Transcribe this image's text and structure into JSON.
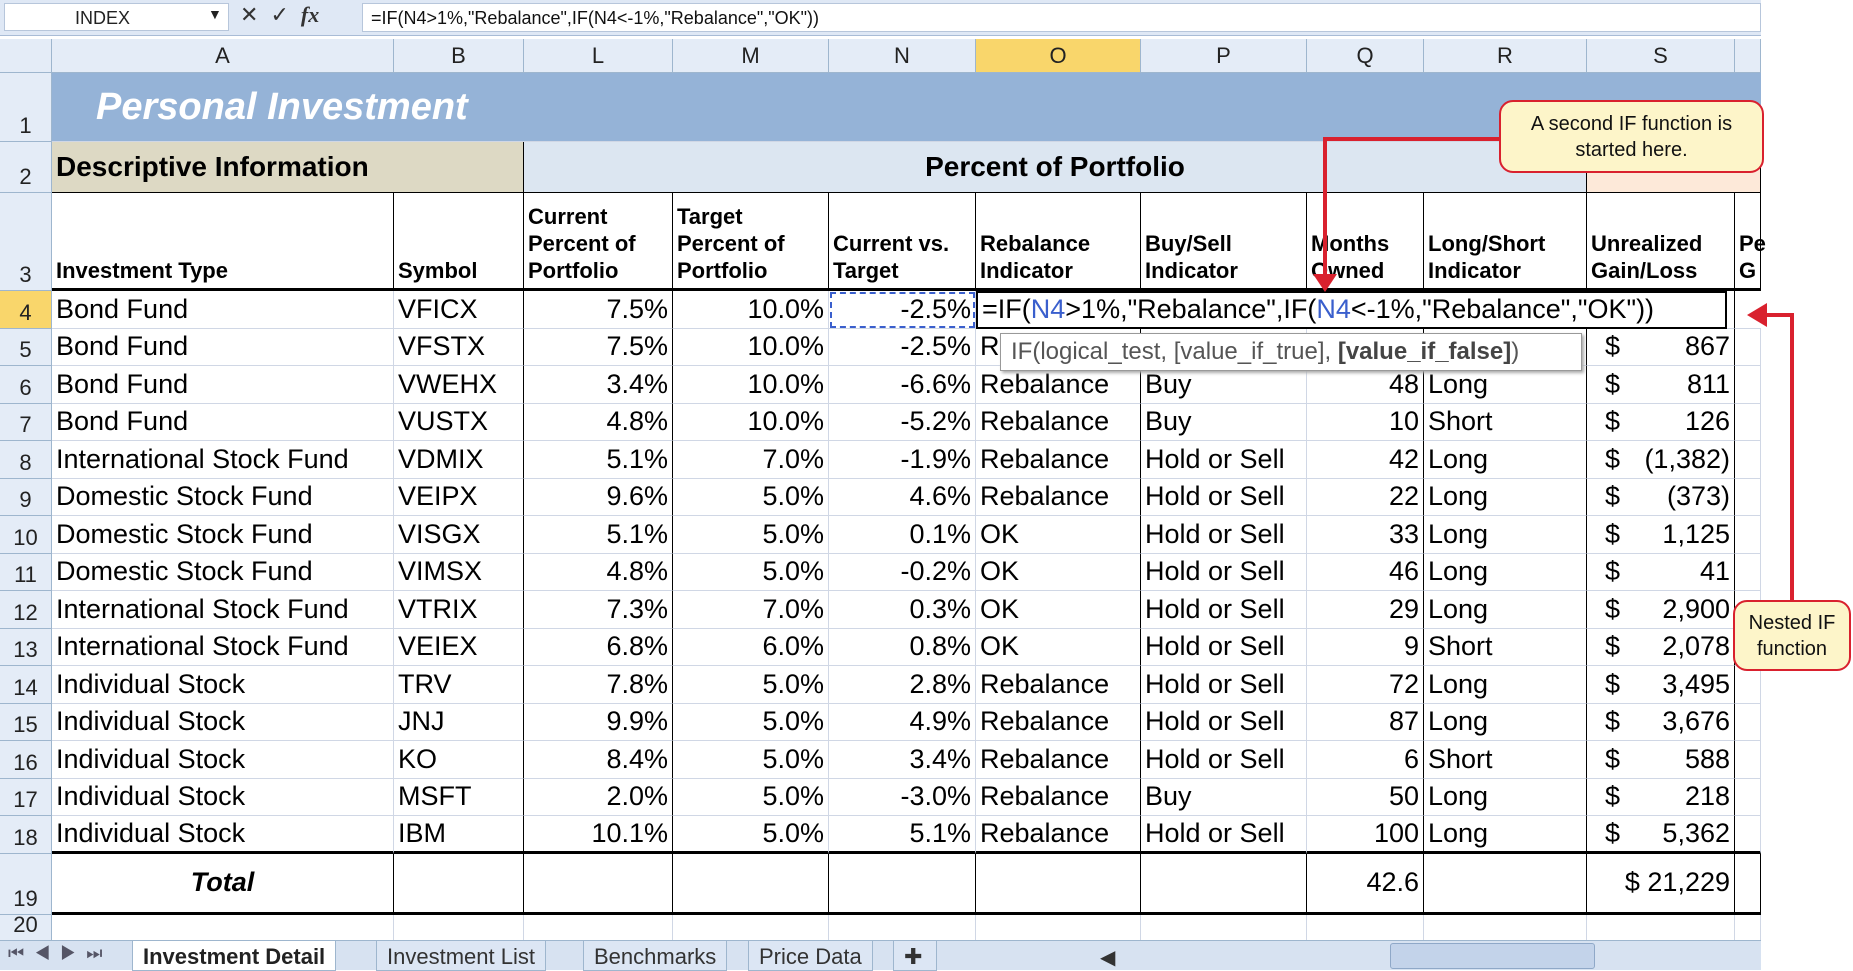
{
  "formula_bar": {
    "name_box": "INDEX",
    "formula": "=IF(N4>1%,\"Rebalance\",IF(N4<-1%,\"Rebalance\",\"OK\"))",
    "cancel": "✕",
    "enter": "✓",
    "fx": "fx"
  },
  "columns": [
    "A",
    "B",
    "L",
    "M",
    "N",
    "O",
    "P",
    "Q",
    "R",
    "S",
    ""
  ],
  "active_column": "O",
  "active_row": "4",
  "title": "Personal Investment",
  "section_descriptive": "Descriptive Information",
  "section_percent": "Percent of Portfolio",
  "headers": [
    "Investment Type",
    "Symbol",
    "Current Percent of Portfolio",
    "Target Percent of Portfolio",
    "Current vs. Target",
    "Rebalance Indicator",
    "Buy/Sell Indicator",
    "Months Owned",
    "Long/Short Indicator",
    "Unrealized Gain/Loss",
    "Pe G"
  ],
  "rows": [
    [
      "Bond Fund",
      "VFICX",
      "7.5%",
      "10.0%",
      "-2.5%",
      "",
      "",
      "",
      "",
      "",
      ""
    ],
    [
      "Bond Fund",
      "VFSTX",
      "7.5%",
      "10.0%",
      "-2.5%",
      "R",
      "",
      "",
      "",
      "867"
    ],
    [
      "Bond Fund",
      "VWEHX",
      "3.4%",
      "10.0%",
      "-6.6%",
      "Rebalance",
      "Buy",
      "48",
      "Long",
      "811"
    ],
    [
      "Bond Fund",
      "VUSTX",
      "4.8%",
      "10.0%",
      "-5.2%",
      "Rebalance",
      "Buy",
      "10",
      "Short",
      "126"
    ],
    [
      "International Stock Fund",
      "VDMIX",
      "5.1%",
      "7.0%",
      "-1.9%",
      "Rebalance",
      "Hold or Sell",
      "42",
      "Long",
      "(1,382)"
    ],
    [
      "Domestic Stock Fund",
      "VEIPX",
      "9.6%",
      "5.0%",
      "4.6%",
      "Rebalance",
      "Hold or Sell",
      "22",
      "Long",
      "(373)"
    ],
    [
      "Domestic Stock Fund",
      "VISGX",
      "5.1%",
      "5.0%",
      "0.1%",
      "OK",
      "Hold or Sell",
      "33",
      "Long",
      "1,125"
    ],
    [
      "Domestic Stock Fund",
      "VIMSX",
      "4.8%",
      "5.0%",
      "-0.2%",
      "OK",
      "Hold or Sell",
      "46",
      "Long",
      "41"
    ],
    [
      "International Stock Fund",
      "VTRIX",
      "7.3%",
      "7.0%",
      "0.3%",
      "OK",
      "Hold or Sell",
      "29",
      "Long",
      "2,900"
    ],
    [
      "International Stock Fund",
      "VEIEX",
      "6.8%",
      "6.0%",
      "0.8%",
      "OK",
      "Hold or Sell",
      "9",
      "Short",
      "2,078"
    ],
    [
      "Individual Stock",
      "TRV",
      "7.8%",
      "5.0%",
      "2.8%",
      "Rebalance",
      "Hold or Sell",
      "72",
      "Long",
      "3,495"
    ],
    [
      "Individual Stock",
      "JNJ",
      "9.9%",
      "5.0%",
      "4.9%",
      "Rebalance",
      "Hold or Sell",
      "87",
      "Long",
      "3,676"
    ],
    [
      "Individual Stock",
      "KO",
      "8.4%",
      "5.0%",
      "3.4%",
      "Rebalance",
      "Hold or Sell",
      "6",
      "Short",
      "588"
    ],
    [
      "Individual Stock",
      "MSFT",
      "2.0%",
      "5.0%",
      "-3.0%",
      "Rebalance",
      "Buy",
      "50",
      "Long",
      "218"
    ],
    [
      "Individual Stock",
      "IBM",
      "10.1%",
      "5.0%",
      "5.1%",
      "Rebalance",
      "Hold or Sell",
      "100",
      "Long",
      "5,362"
    ]
  ],
  "currency": "$",
  "total": {
    "label": "Total",
    "months": "42.6",
    "gain": "$ 21,229"
  },
  "in_cell_formula": {
    "p1": "=IF(",
    "r1": "N4",
    "p2": ">1%,\"Rebalance\",IF(",
    "r2": "N4",
    "p3": "<-1%,\"Rebalance\",\"OK\"))"
  },
  "tooltip": {
    "text": "IF(logical_test, [value_if_true], ",
    "bold": "[value_if_false]",
    "end": ")"
  },
  "callouts": {
    "second_if": "A second IF function is started here.",
    "nested": "Nested IF function"
  },
  "sheet_tabs": [
    "Investment Detail",
    "Investment List",
    "Benchmarks",
    "Price Data"
  ],
  "active_tab": "Investment Detail",
  "colors": {
    "title_band": "#95b3d7",
    "descriptive_band": "#ddd9c4",
    "percent_band": "#dce6f1",
    "gain_band": "#fde9d9",
    "callout_border": "#d9212e",
    "cell_ref": "#3a5fcd"
  }
}
